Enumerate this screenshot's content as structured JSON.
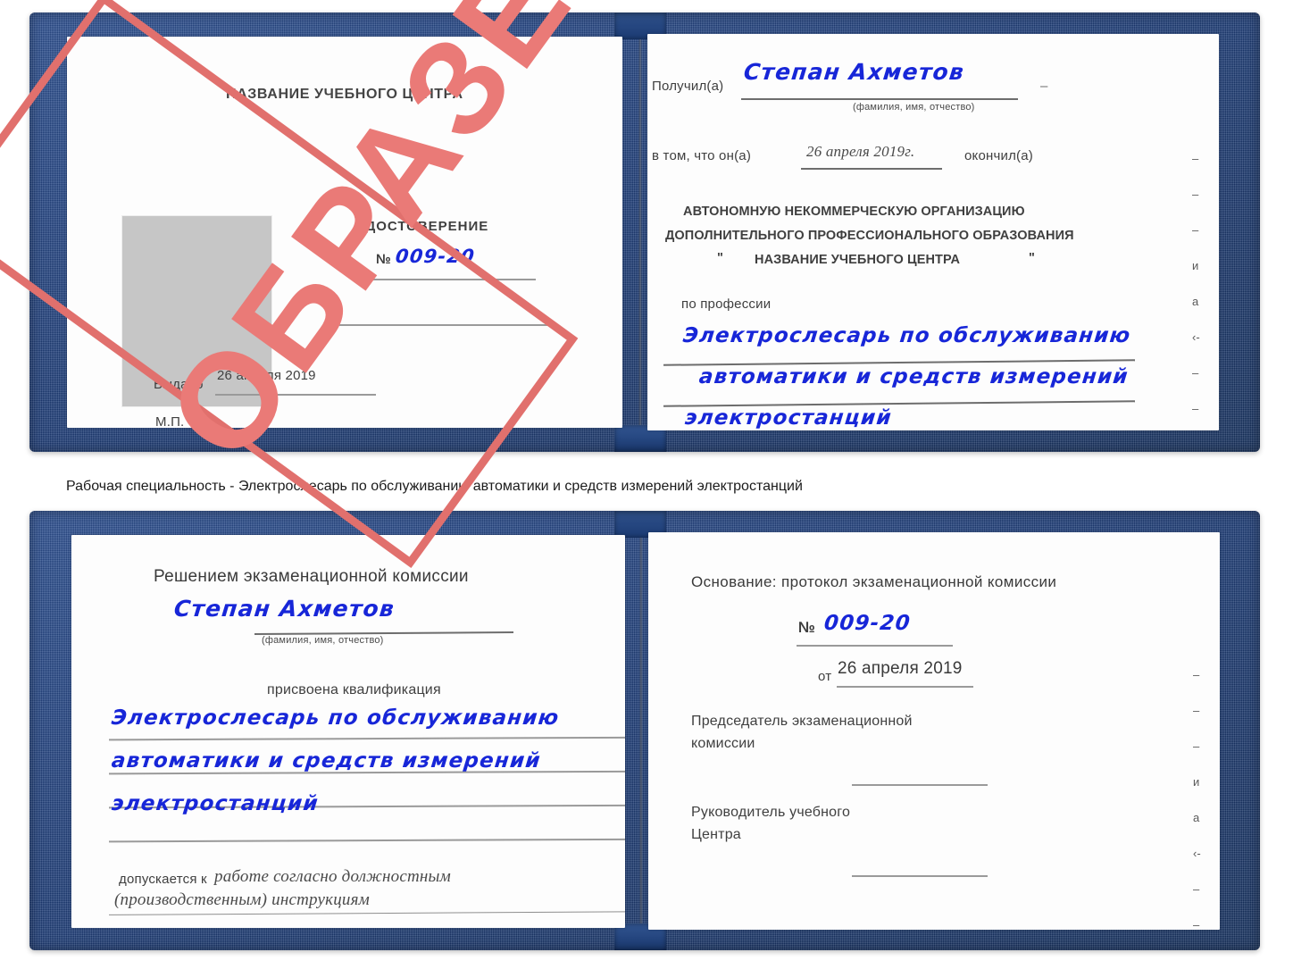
{
  "document": {
    "kind": "certificate-scan",
    "caption": "Рабочая специальность - Электрослесарь по обслуживанию автоматики и средств измерений электростанций"
  },
  "colors": {
    "cover_blue": "#1e3d78",
    "stamp_red": "#e1706d",
    "handwriting_blue": "#1726d8",
    "print_gray": "#3f3f3f",
    "rule_gray": "#9a9a9a",
    "photo_gray": "#c6c6c6"
  },
  "stamp": {
    "text": "ОБРАЗЕЦ"
  },
  "certificate_top": {
    "left_page": {
      "heading": "НАЗВАНИЕ УЧЕБНОГО ЦЕНТРА",
      "doc_type": "УДОСТОВЕРЕНИЕ",
      "number_label": "№",
      "number_value": "009-20",
      "issued_label": "Выдано",
      "issued_value": "26 апреля 2019",
      "seal_label": "М.П."
    },
    "right_page": {
      "received_label": "Получил(а)",
      "received_value": "Степан Ахметов",
      "fio_hint": "(фамилия, имя, отчество)",
      "that_he_label": "в том, что он(а)",
      "completion_date": "26 апреля 2019г.",
      "finished_label": "окончил(а)",
      "org_line1": "АВТОНОМНУЮ НЕКОММЕРЧЕСКУЮ ОРГАНИЗАЦИЮ",
      "org_line2": "ДОПОЛНИТЕЛЬНОГО ПРОФЕССИОНАЛЬНОГО ОБРАЗОВАНИЯ",
      "org_quote_open": "\"",
      "org_name": "НАЗВАНИЕ УЧЕБНОГО ЦЕНТРА",
      "org_quote_close": "\"",
      "profession_label": "по профессии",
      "profession_line1": "Электрослесарь по обслуживанию",
      "profession_line2": "автоматики и средств измерений",
      "profession_line3": "электростанций",
      "edge_fragments": [
        "–",
        "–",
        "–",
        "и",
        "а",
        "‹-",
        "–",
        "–",
        "–"
      ]
    }
  },
  "certificate_bottom": {
    "left_page": {
      "heading": "Решением экзаменационной комиссии",
      "name_value": "Степан Ахметов",
      "fio_hint": "(фамилия, имя, отчество)",
      "qualification_label": "присвоена квалификация",
      "qualification_line1": "Электрослесарь по обслуживанию",
      "qualification_line2": "автоматики и средств измерений",
      "qualification_line3": "электростанций",
      "allowed_label": "допускается к",
      "allowed_value_line1": "работе согласно должностным",
      "allowed_value_line2": "(производственным) инструкциям"
    },
    "right_page": {
      "basis_label": "Основание: протокол экзаменационной комиссии",
      "number_label": "№",
      "number_value": "009-20",
      "from_label": "от",
      "from_value": "26 апреля 2019",
      "chairman_line1": "Председатель экзаменационной",
      "chairman_line2": "комиссии",
      "head_line1": "Руководитель учебного",
      "head_line2": "Центра",
      "edge_fragments": [
        "–",
        "–",
        "–",
        "и",
        "а",
        "‹-",
        "–",
        "–",
        "–",
        "–"
      ]
    }
  }
}
